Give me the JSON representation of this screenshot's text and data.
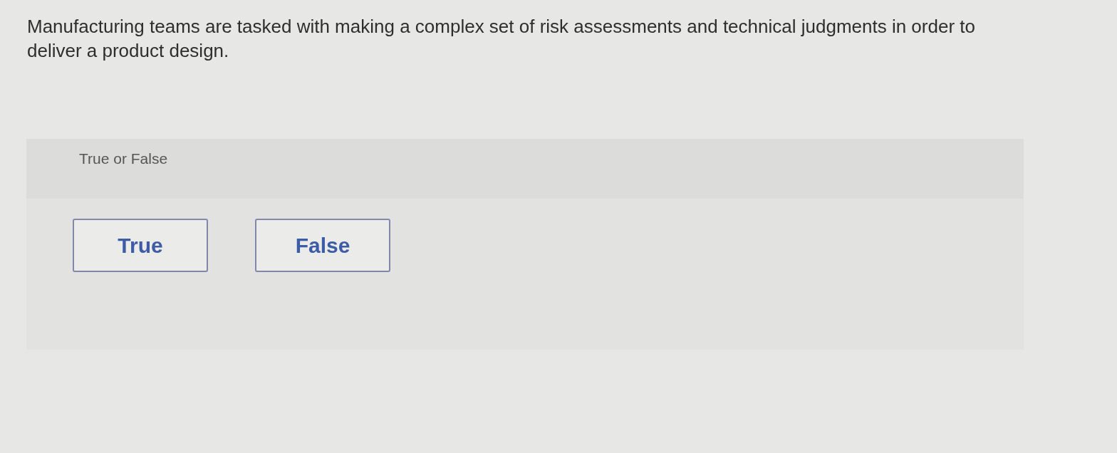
{
  "question": {
    "text": "Manufacturing teams are tasked with making a complex set of risk assessments and technical judgments in order to deliver a product design."
  },
  "answer_panel": {
    "label": "True or False",
    "options": [
      {
        "label": "True",
        "selected": false
      },
      {
        "label": "False",
        "selected": false
      }
    ]
  }
}
